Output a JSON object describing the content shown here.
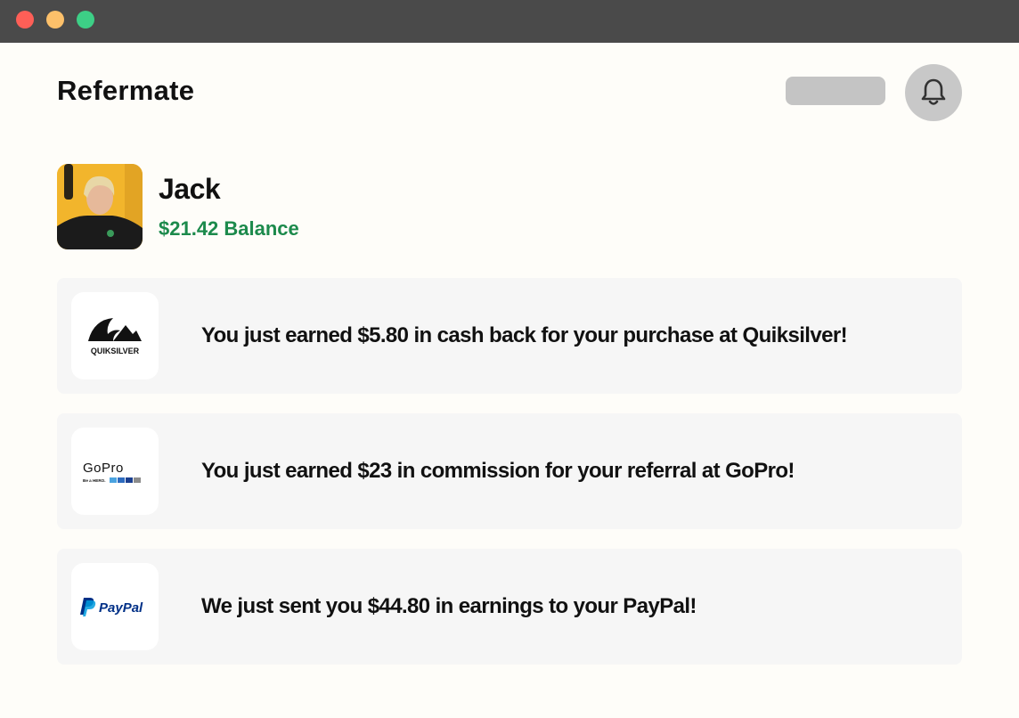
{
  "window": {
    "controls": [
      {
        "name": "close",
        "color": "#fe5f57"
      },
      {
        "name": "minimize",
        "color": "#fcc06a"
      },
      {
        "name": "maximize",
        "color": "#3dcf86"
      }
    ]
  },
  "header": {
    "brand": "Refermate",
    "bell_icon": "bell-icon"
  },
  "user": {
    "name": "Jack",
    "balance": "$21.42 Balance",
    "balance_color": "#1c8a4c"
  },
  "notifications": [
    {
      "logo": "quiksilver-logo",
      "logo_text": "QUIKSILVER",
      "message": "You just earned $5.80 in cash back for your purchase at Quiksilver!"
    },
    {
      "logo": "gopro-logo",
      "logo_text": "GoPro",
      "logo_tagline": "Be a HERO.",
      "message": "You just earned $23 in commission for your referral at GoPro!"
    },
    {
      "logo": "paypal-logo",
      "logo_text": "PayPal",
      "message": "We just sent you $44.80 in earnings to your PayPal!"
    }
  ]
}
